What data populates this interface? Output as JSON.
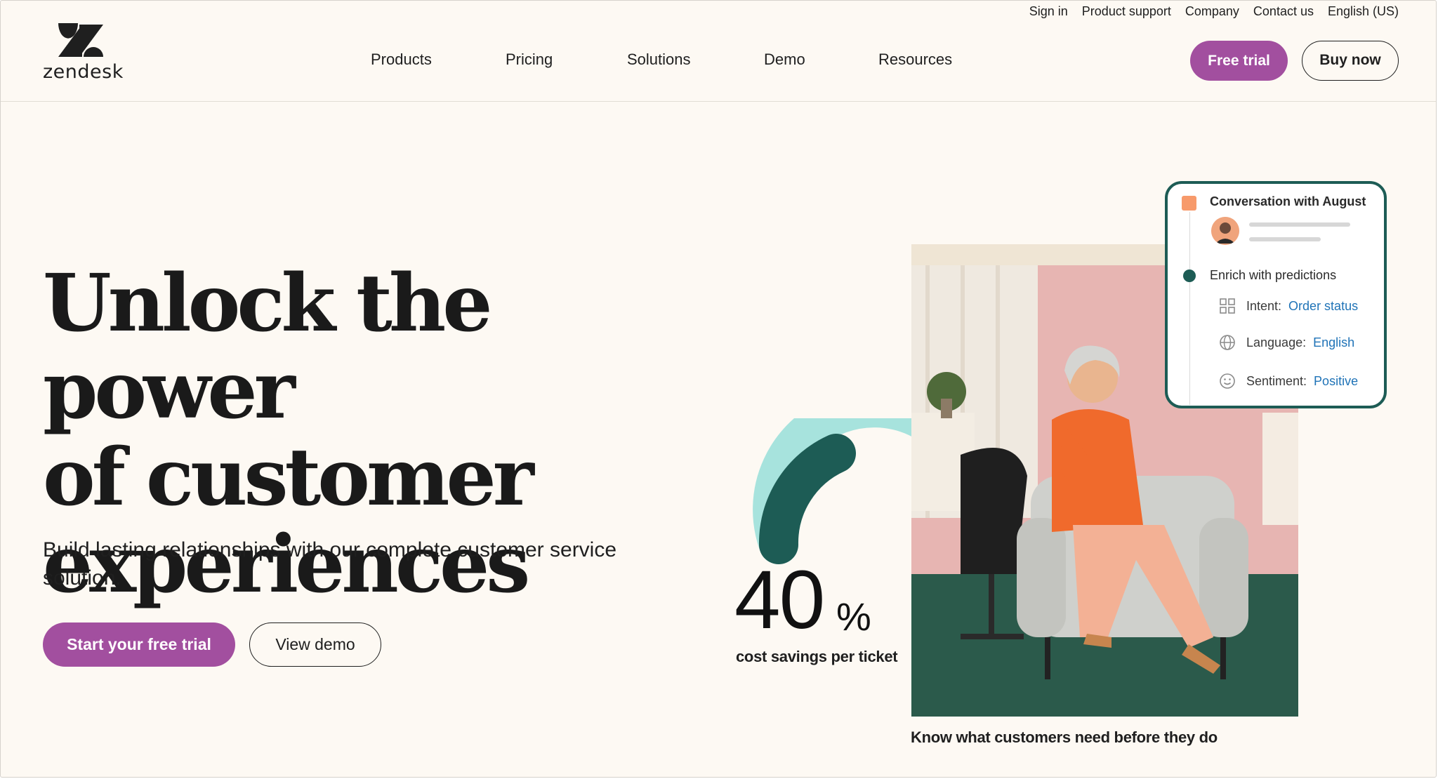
{
  "brand": {
    "name": "zendesk",
    "accent": "#a24f9f",
    "teal": "#1d5c55"
  },
  "util_nav": [
    "Sign in",
    "Product support",
    "Company",
    "Contact us",
    "English (US)"
  ],
  "main_nav": [
    "Products",
    "Pricing",
    "Solutions",
    "Demo",
    "Resources"
  ],
  "header": {
    "free_trial": "Free trial",
    "buy_now": "Buy now"
  },
  "hero": {
    "title_lines": [
      "Unlock the power",
      "of customer",
      "experiences"
    ],
    "subtitle": "Build lasting relationships with our complete customer service solution.",
    "cta_primary": "Start your free trial",
    "cta_secondary": "View demo"
  },
  "stat": {
    "number": "40",
    "unit": "%",
    "label": "cost savings per ticket",
    "progress": 0.4
  },
  "caption": "Know what customers need before they do",
  "card": {
    "title": "Conversation with August",
    "enrich": "Enrich with predictions",
    "rows": [
      {
        "icon": "grid-icon",
        "label": "Intent:",
        "value": "Order status"
      },
      {
        "icon": "globe-icon",
        "label": "Language:",
        "value": "English"
      },
      {
        "icon": "smiley-icon",
        "label": "Sentiment:",
        "value": "Positive"
      }
    ]
  }
}
